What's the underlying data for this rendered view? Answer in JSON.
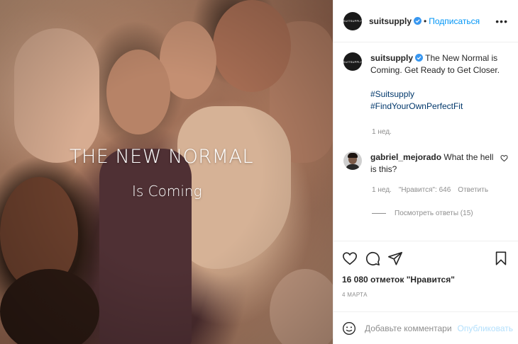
{
  "post": {
    "image": {
      "headline": "THE NEW NORMAL",
      "subline": "Is Coming"
    },
    "header": {
      "avatar_text": "SUITSUPPLY",
      "username": "suitsupply",
      "separator": "•",
      "follow_label": "Подписаться",
      "more_label": "•••"
    },
    "caption": {
      "username": "suitsupply",
      "text": " The New Normal is Coming. Get Ready to Get Closer.",
      "hashtags": [
        "#Suitsupply",
        "#FindYourOwnPerfectFit"
      ],
      "time": "1 нед."
    },
    "comments": [
      {
        "username": "gabriel_mejorado",
        "text": " What the hell is this?",
        "time": "1 нед.",
        "likes": "\"Нравится\": 646",
        "reply_label": "Ответить",
        "view_replies": "Посмотреть ответы (15)"
      }
    ],
    "likes_text": "16 080 отметок \"Нравится\"",
    "date": "4 марта",
    "add_comment": {
      "placeholder": "Добавьте комментарий...",
      "publish_label": "Опубликовать"
    },
    "colors": {
      "accent": "#0095f6",
      "publish_disabled": "#b2dffc",
      "hashtag": "#00376b",
      "muted": "#8e8e8e"
    }
  }
}
